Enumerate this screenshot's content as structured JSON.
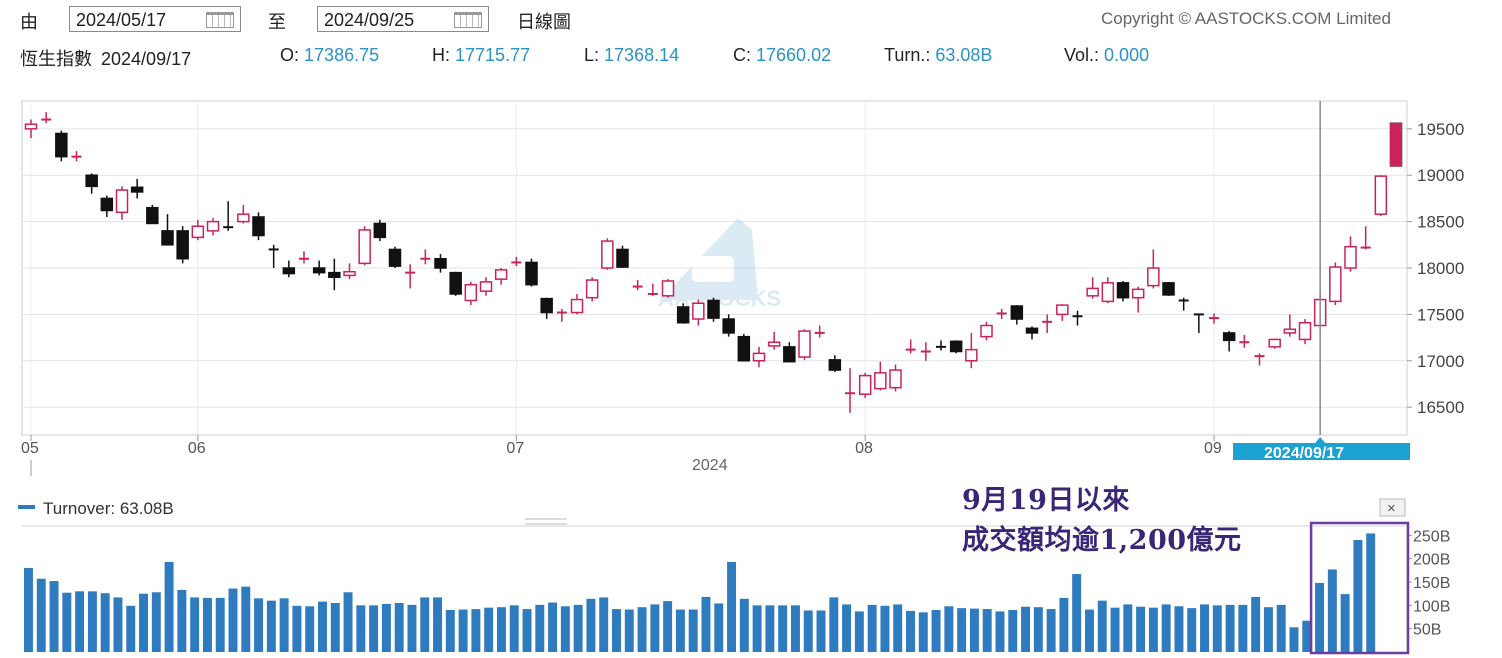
{
  "controls": {
    "from_label": "由",
    "from_date": "2024/05/17",
    "to_label": "至",
    "to_date": "2024/09/25",
    "period_label": "日線圖",
    "copyright": "Copyright © AASTOCKS.COM Limited",
    "watermark": "AASTOCKS"
  },
  "quote": {
    "name": "恆生指數",
    "date": "2024/09/17",
    "open_label": "O:",
    "open": "17386.75",
    "high_label": "H:",
    "high": "17715.77",
    "low_label": "L:",
    "low": "17368.14",
    "close_label": "C:",
    "close": "17660.02",
    "turn_label": "Turn.:",
    "turn": "63.08B",
    "vol_label": "Vol.:",
    "vol": "0.000"
  },
  "turnover_legend": "Turnover: 63.08B",
  "annotation": {
    "line1": "9月19日以來",
    "line2": "成交額均逾1,200億元"
  },
  "colors": {
    "up": "#c8235a",
    "down": "#111111",
    "bar": "#2f7bbf",
    "accent": "#1ba2d2",
    "highlight": "#6a3fa0"
  },
  "chart_data": [
    {
      "type": "candlestick",
      "x_tick_labels": [
        "05",
        "06",
        "07",
        "08",
        "09"
      ],
      "year_label": "2024",
      "crosshair_label": "2024/09/17",
      "ylim": [
        16200,
        19800
      ],
      "yticks": [
        16500,
        17000,
        17500,
        18000,
        18500,
        19000,
        19500
      ],
      "ohlc": [
        [
          19500,
          19600,
          19400,
          19550
        ],
        [
          19600,
          19680,
          19560,
          19620
        ],
        [
          19450,
          19480,
          19150,
          19200
        ],
        [
          19200,
          19260,
          19150,
          19210
        ],
        [
          19000,
          19020,
          18800,
          18880
        ],
        [
          18750,
          18780,
          18550,
          18620
        ],
        [
          18600,
          18880,
          18520,
          18840
        ],
        [
          18870,
          18960,
          18750,
          18820
        ],
        [
          18650,
          18680,
          18500,
          18480
        ],
        [
          18400,
          18580,
          18300,
          18250
        ],
        [
          18400,
          18450,
          18050,
          18100
        ],
        [
          18330,
          18520,
          18300,
          18450
        ],
        [
          18400,
          18540,
          18350,
          18500
        ],
        [
          18440,
          18720,
          18400,
          18420
        ],
        [
          18500,
          18680,
          18480,
          18580
        ],
        [
          18550,
          18600,
          18300,
          18350
        ],
        [
          18200,
          18250,
          18000,
          18180
        ],
        [
          18000,
          18080,
          17900,
          17940
        ],
        [
          18100,
          18180,
          18050,
          18120
        ],
        [
          18000,
          18080,
          17920,
          17950
        ],
        [
          17950,
          18100,
          17760,
          17900
        ],
        [
          17920,
          18050,
          17880,
          17960
        ],
        [
          18050,
          18450,
          18030,
          18410
        ],
        [
          18480,
          18520,
          18290,
          18330
        ],
        [
          18200,
          18230,
          18000,
          18020
        ],
        [
          17950,
          18040,
          17780,
          17950
        ],
        [
          18100,
          18200,
          18040,
          18130
        ],
        [
          18100,
          18150,
          17950,
          18000
        ],
        [
          17950,
          17960,
          17700,
          17720
        ],
        [
          17650,
          17850,
          17600,
          17820
        ],
        [
          17750,
          17900,
          17700,
          17850
        ],
        [
          17880,
          18000,
          17820,
          17980
        ],
        [
          18060,
          18120,
          18020,
          18070
        ],
        [
          18060,
          18100,
          17800,
          17820
        ],
        [
          17670,
          17680,
          17450,
          17520
        ],
        [
          17520,
          17560,
          17420,
          17520
        ],
        [
          17520,
          17720,
          17500,
          17660
        ],
        [
          17680,
          17900,
          17640,
          17870
        ],
        [
          18000,
          18320,
          17980,
          18290
        ],
        [
          18200,
          18240,
          18000,
          18010
        ],
        [
          17800,
          17870,
          17760,
          17800
        ],
        [
          17720,
          17830,
          17700,
          17740
        ],
        [
          17700,
          17880,
          17680,
          17860
        ],
        [
          17580,
          17620,
          17400,
          17410
        ],
        [
          17450,
          17660,
          17380,
          17620
        ],
        [
          17650,
          17680,
          17420,
          17460
        ],
        [
          17450,
          17500,
          17260,
          17300
        ],
        [
          17260,
          17290,
          17000,
          17000
        ],
        [
          17000,
          17150,
          16930,
          17080
        ],
        [
          17160,
          17310,
          17120,
          17200
        ],
        [
          17150,
          17200,
          17020,
          16990
        ],
        [
          17040,
          17340,
          17010,
          17320
        ],
        [
          17300,
          17380,
          17250,
          17310
        ],
        [
          17010,
          17060,
          16880,
          16900
        ],
        [
          16650,
          16920,
          16440,
          16680
        ],
        [
          16640,
          16870,
          16600,
          16840
        ],
        [
          16700,
          16990,
          16680,
          16870
        ],
        [
          16710,
          16960,
          16670,
          16900
        ],
        [
          17120,
          17230,
          17080,
          17120
        ],
        [
          17100,
          17200,
          17000,
          17110
        ],
        [
          17150,
          17220,
          17110,
          17140
        ],
        [
          17210,
          17220,
          17080,
          17100
        ],
        [
          17000,
          17300,
          16920,
          17120
        ],
        [
          17260,
          17420,
          17220,
          17380
        ],
        [
          17510,
          17560,
          17450,
          17510
        ],
        [
          17590,
          17600,
          17390,
          17450
        ],
        [
          17350,
          17370,
          17230,
          17300
        ],
        [
          17420,
          17500,
          17300,
          17440
        ],
        [
          17500,
          17610,
          17430,
          17600
        ],
        [
          17480,
          17540,
          17380,
          17460
        ],
        [
          17700,
          17900,
          17670,
          17780
        ],
        [
          17640,
          17900,
          17620,
          17840
        ],
        [
          17840,
          17860,
          17640,
          17680
        ],
        [
          17680,
          17800,
          17520,
          17770
        ],
        [
          17810,
          18200,
          17780,
          18000
        ],
        [
          17840,
          17850,
          17700,
          17710
        ],
        [
          17650,
          17680,
          17540,
          17640
        ],
        [
          17500,
          17500,
          17300,
          17480
        ],
        [
          17460,
          17510,
          17400,
          17480
        ],
        [
          17300,
          17320,
          17100,
          17220
        ],
        [
          17200,
          17280,
          17140,
          17220
        ],
        [
          17050,
          17080,
          16950,
          17080
        ],
        [
          17150,
          17240,
          17130,
          17230
        ],
        [
          17300,
          17500,
          17260,
          17340
        ],
        [
          17230,
          17450,
          17180,
          17410
        ],
        [
          17380,
          17720,
          17370,
          17660
        ],
        [
          17640,
          18060,
          17600,
          18010
        ],
        [
          18000,
          18340,
          17960,
          18230
        ],
        [
          18220,
          18450,
          18200,
          18230
        ],
        [
          18580,
          19000,
          18560,
          18990
        ],
        [
          19560,
          19560,
          19100,
          19100
        ]
      ],
      "crosshair_index": 85
    },
    {
      "type": "bar",
      "title": "Turnover",
      "yticks": [
        "250B",
        "200B",
        "150B",
        "100B",
        "50B"
      ],
      "ylim": [
        0,
        270
      ],
      "values": [
        180,
        157,
        152,
        127,
        130,
        130,
        126,
        117,
        99,
        125,
        128,
        193,
        133,
        117,
        116,
        116,
        136,
        140,
        115,
        110,
        115,
        99,
        98,
        108,
        105,
        128,
        100,
        100,
        103,
        105,
        101,
        117,
        117,
        90,
        91,
        92,
        95,
        96,
        100,
        92,
        101,
        106,
        98,
        101,
        114,
        117,
        92,
        91,
        96,
        102,
        109,
        91,
        91,
        118,
        104,
        193,
        114,
        100,
        100,
        100,
        100,
        89,
        89,
        117,
        102,
        87,
        101,
        99,
        102,
        88,
        85,
        90,
        98,
        94,
        93,
        92,
        87,
        90,
        97,
        96,
        92,
        116,
        167,
        91,
        110,
        95,
        102,
        97,
        95,
        102,
        98,
        94,
        102,
        100,
        101,
        101,
        118,
        96,
        101,
        53,
        67,
        148,
        177,
        124,
        240,
        254
      ],
      "highlight_from_index": 101
    }
  ]
}
